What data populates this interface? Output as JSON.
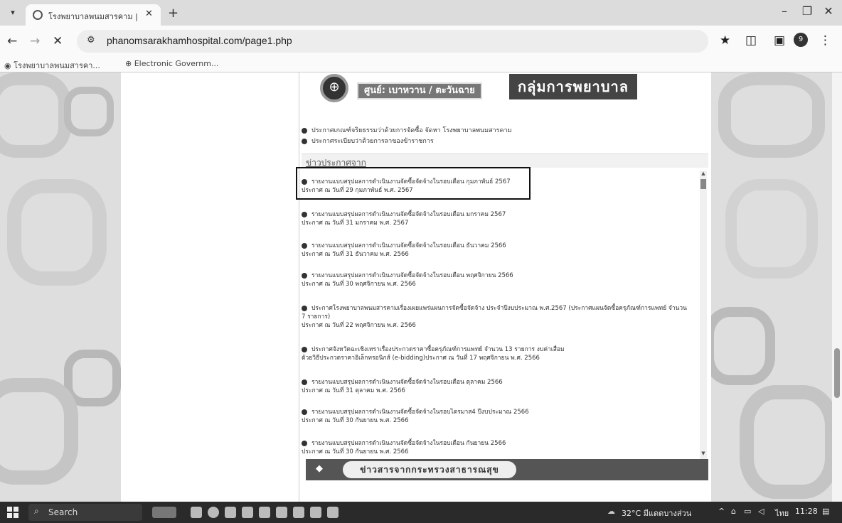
{
  "browser": {
    "tab_title": "โรงพยาบาลพนมสารคาม | phanom",
    "url": "phanomsarakhamhospital.com/page1.php",
    "bookmarks": [
      {
        "label": "โรงพยาบาลพนมสารคา..."
      },
      {
        "label": "Electronic Governm..."
      }
    ],
    "profile_initial": "9"
  },
  "page": {
    "banner": {
      "label": "ศูนย์: เบาหวาน / ตะวันฉาย",
      "title": "กลุ่มการพยาบาล"
    },
    "top_links": [
      "ประกาศเกณฑ์จริยธรรมว่าด้วยการจัดซื้อ จัดหา โรงพยาบาลพนมสารคาม",
      "ประกาศระเบียบว่าด้วยการลาของข้าราชการ"
    ],
    "news_heading": "ข่าวประกาศจาก",
    "news": [
      {
        "title": "รายงานแบบสรุปผลการดำเนินงานจัดซื้อจัดจ้างในรอบเดือน กุมภาพันธ์ 2567",
        "date": "ประกาศ ณ วันที่ 29 กุมภาพันธ์ พ.ศ. 2567"
      },
      {
        "title": "รายงานแบบสรุปผลการดำเนินงานจัดซื้อจัดจ้างในรอบเดือน มกราคม 2567",
        "date": "ประกาศ ณ วันที่ 31 มกราคม พ.ศ. 2567"
      },
      {
        "title": "รายงานแบบสรุปผลการดำเนินงานจัดซื้อจัดจ้างในรอบเดือน ธันวาคม 2566",
        "date": "ประกาศ ณ วันที่ 31 ธันวาคม พ.ศ. 2566"
      },
      {
        "title": "รายงานแบบสรุปผลการดำเนินงานจัดซื้อจัดจ้างในรอบเดือน พฤศจิกายน 2566",
        "date": "ประกาศ ณ วันที่ 30 พฤศจิกายน พ.ศ. 2566"
      },
      {
        "title": "ประกาศโรงพยาบาลพนมสารคามเรื่องเผยแพร่แผนการจัดซื้อจัดจ้าง ประจำปีงบประมาณ พ.ศ.2567 (ประกาศแผนจัดซื้อครุภัณฑ์การแพทย์ จำนวน 7 รายการ)",
        "date": "ประกาศ ณ วันที่ 22 พฤศจิกายน พ.ศ. 2566"
      },
      {
        "title": "ประกาศจังหวัดฉะเชิงเทราเรื่องประกวดราคาซื้อครุภัณฑ์การแพทย์ จำนวน 13 รายการ งบค่าเสื่อม",
        "date": "ด้วยวิธีประกวดราคาอิเล็กทรอนิกส์ (e-bidding)ประกาศ ณ วันที่ 17 พฤศจิกายน พ.ศ. 2566"
      },
      {
        "title": "รายงานแบบสรุปผลการดำเนินงานจัดซื้อจัดจ้างในรอบเดือน ตุลาคม 2566",
        "date": "ประกาศ ณ วันที่ 31 ตุลาคม พ.ศ. 2566"
      },
      {
        "title": "รายงานแบบสรุปผลการดำเนินงานจัดซื้อจัดจ้างในรอบไตรมาส4 ปีงบประมาณ 2566",
        "date": "ประกาศ ณ วันที่ 30 กันยายน พ.ศ. 2566"
      },
      {
        "title": "รายงานแบบสรุปผลการดำเนินงานจัดซื้อจัดจ้างในรอบเดือน กันยายน 2566",
        "date": "ประกาศ ณ วันที่ 30 กันยายน พ.ศ. 2566"
      }
    ],
    "footer_banner": "ข่าวสารจากกระทรวงสาธารณสุข"
  },
  "taskbar": {
    "search_label": "Search",
    "weather": "32°C มีแดดบางส่วน",
    "lang": "ไทย",
    "time": "11:28"
  }
}
